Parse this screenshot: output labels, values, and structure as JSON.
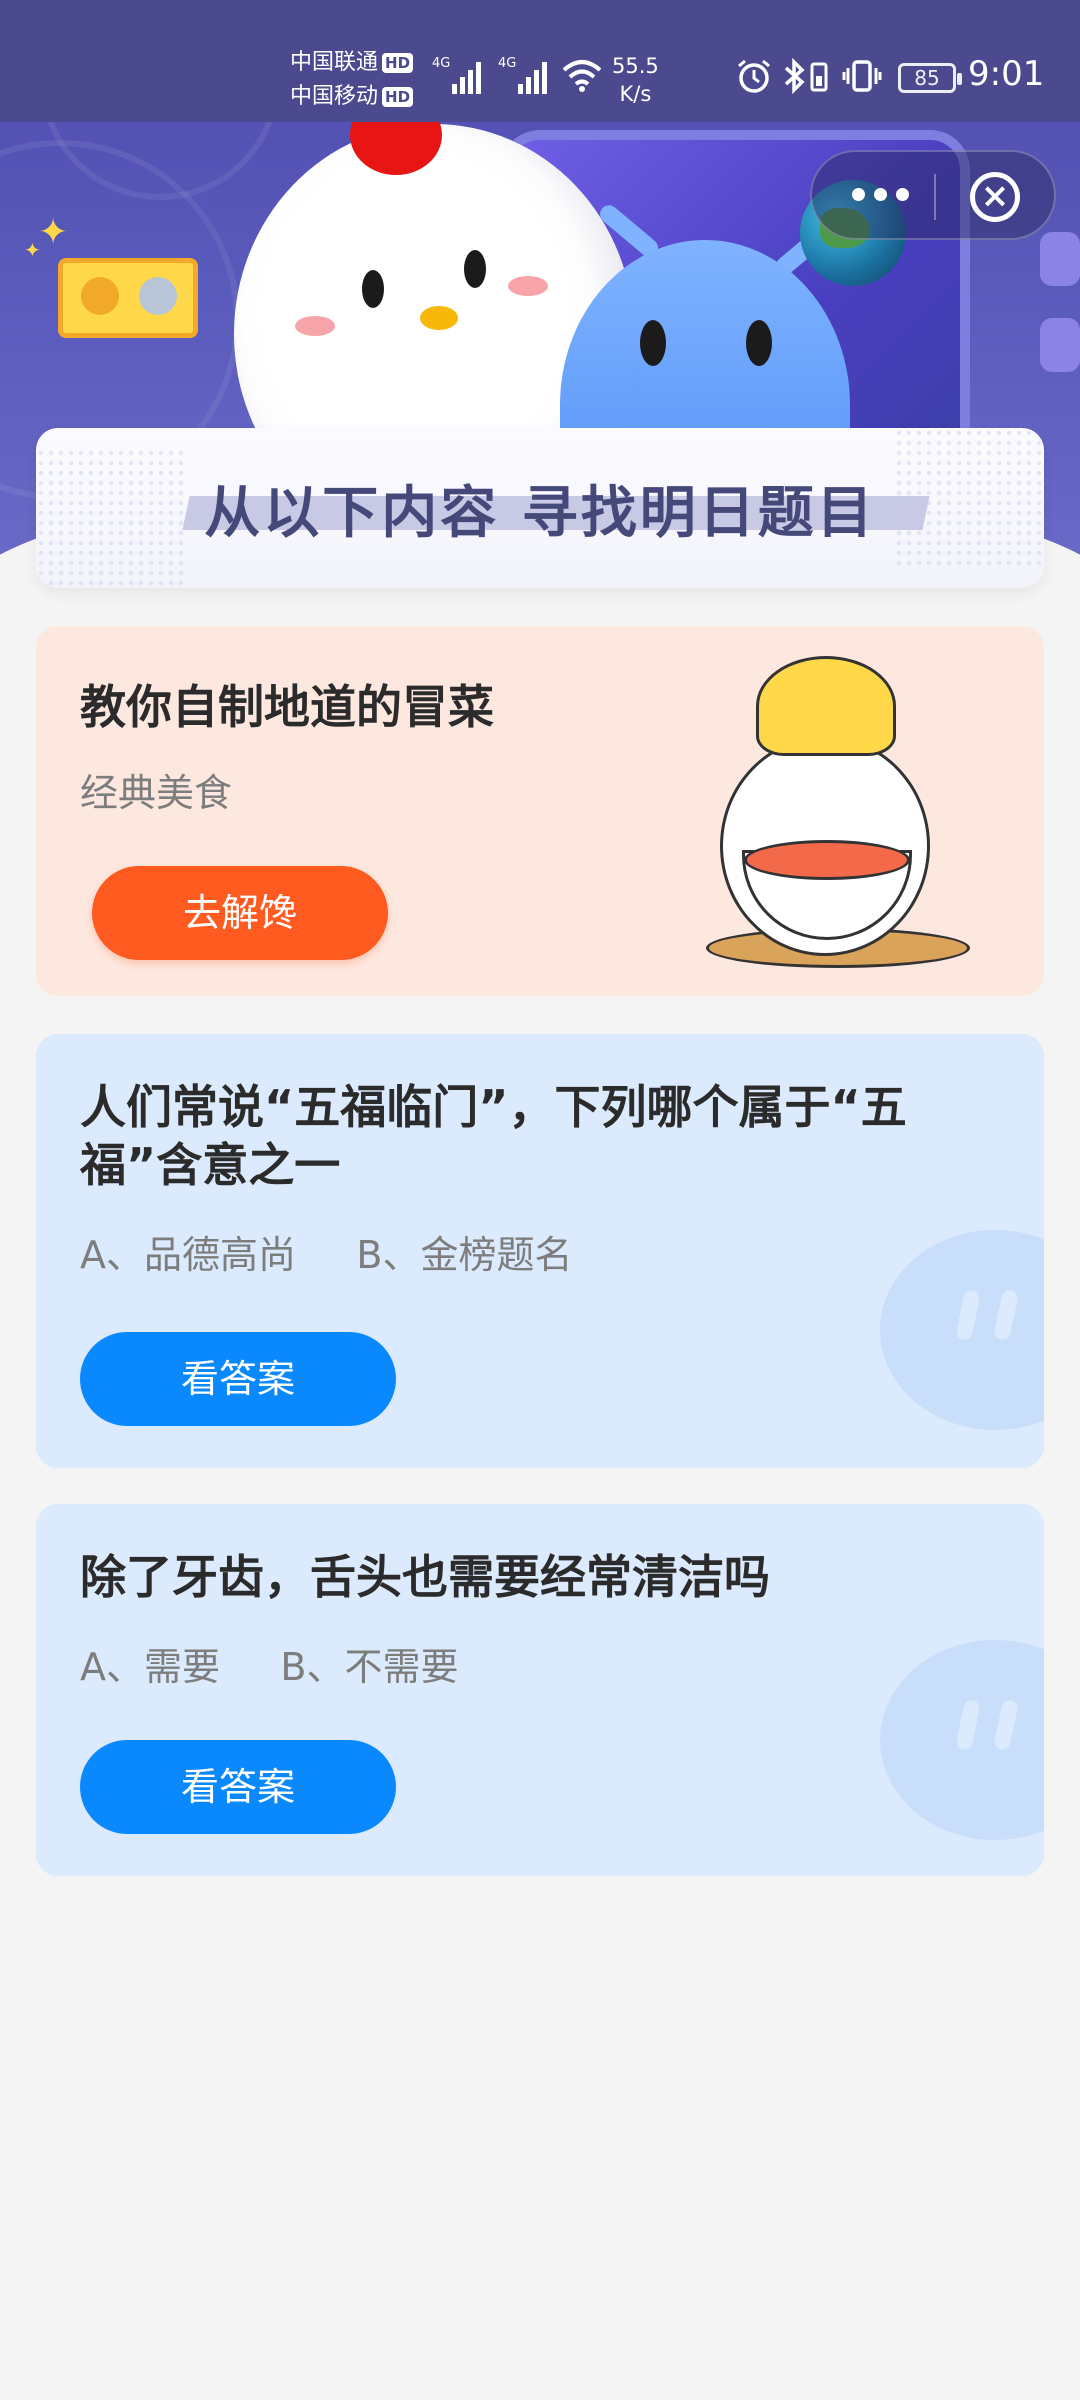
{
  "status_bar": {
    "carrier1": "中国联通",
    "carrier2": "中国移动",
    "hd_badge": "HD",
    "net1": "4G",
    "net2": "4G",
    "speed_value": "55.5",
    "speed_unit": "K/s",
    "battery": "85",
    "time": "9:01"
  },
  "banner": {
    "title": "从以下内容 寻找明日题目"
  },
  "food_card": {
    "title": "教你自制地道的冒菜",
    "subtitle": "经典美食",
    "button": "去解馋"
  },
  "quiz_cards": [
    {
      "question": "人们常说“五福临门”，下列哪个属于“五福”含意之一",
      "options": "A、品德高尚     B、金榜题名",
      "button": "看答案"
    },
    {
      "question": "除了牙齿，舌头也需要经常清洁吗",
      "options": "A、需要     B、不需要",
      "button": "看答案"
    }
  ],
  "colors": {
    "hero": "#5b5cbd",
    "food_button": "#ff5a1f",
    "answer_button": "#0a89ff",
    "food_card_bg": "#fde8e0",
    "quiz_card_bg": "#dbeafd"
  },
  "icons": [
    "alarm-icon",
    "bluetooth-icon",
    "vibrate-icon",
    "wifi-icon",
    "signal-icon",
    "more-icon",
    "close-icon"
  ]
}
